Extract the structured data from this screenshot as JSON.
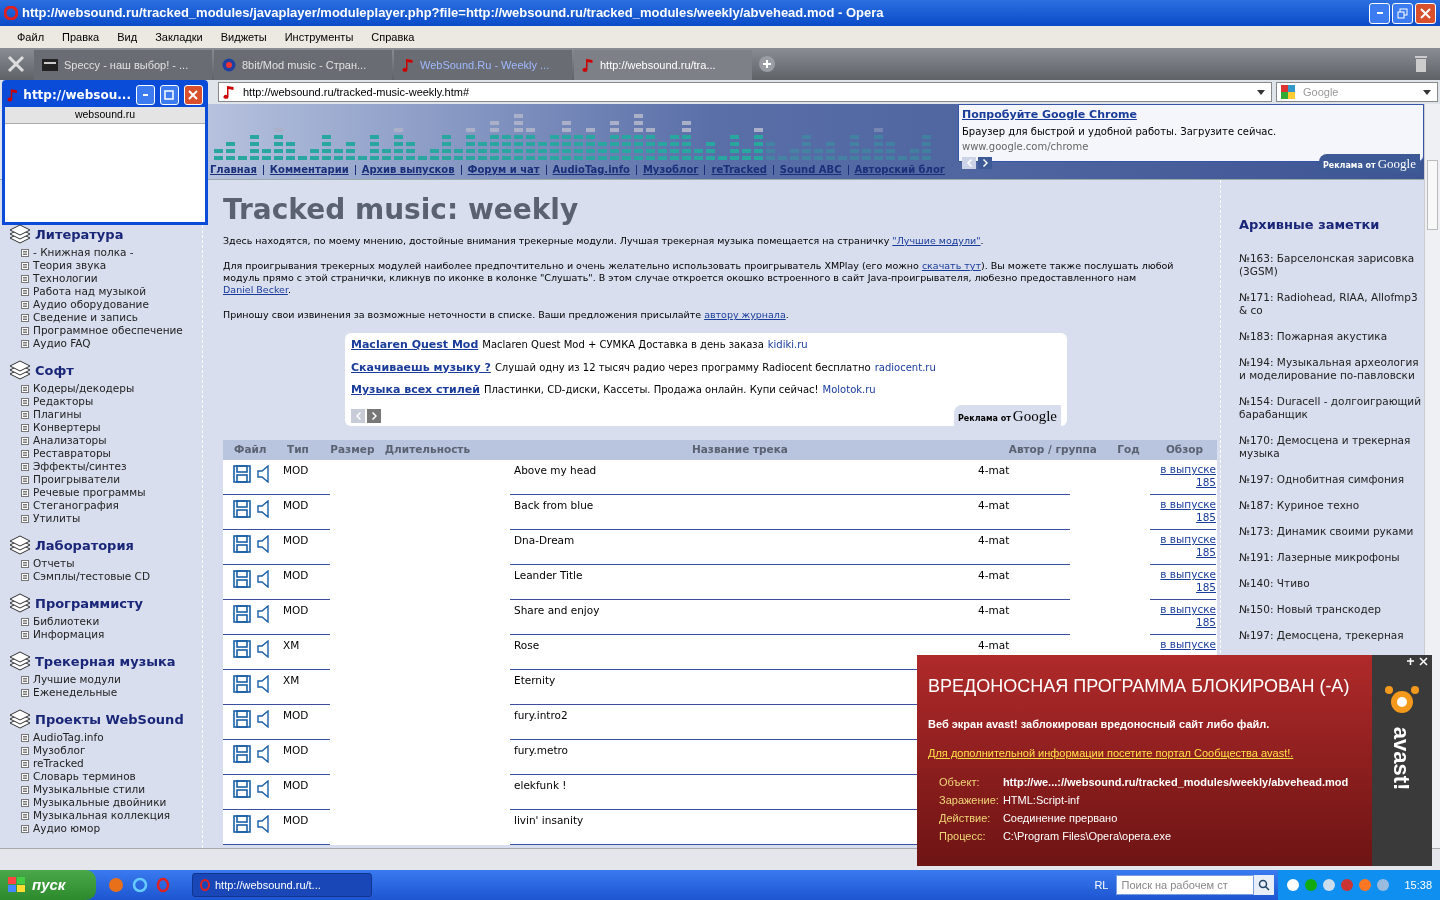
{
  "window": {
    "title": "http://websound.ru/tracked_modules/javaplayer/moduleplayer.php?file=http://websound.ru/tracked_modules/weekly/abvehead.mod - Opera"
  },
  "menu": [
    "Файл",
    "Правка",
    "Вид",
    "Закладки",
    "Виджеты",
    "Инструменты",
    "Справка"
  ],
  "tabs": [
    {
      "label": "Speccy - наш выбор! - ...",
      "selected": false
    },
    {
      "label": "8bit/Mod music - Стран...",
      "selected": false
    },
    {
      "label": "WebSound.Ru - Weekly ...",
      "selected": false
    },
    {
      "label": "http://websound.ru/tra...",
      "selected": true
    }
  ],
  "address": {
    "value": "http://websound.ru/tracked-music-weekly.htm#"
  },
  "search": {
    "placeholder": "Google"
  },
  "mini_window": {
    "title": "http://websou...",
    "header": "websound.ru"
  },
  "top_ad": {
    "title": "Попробуйте Google Chrome",
    "text": "Браузер для быстрой и удобной работы. Загрузите сейчас.",
    "url": "www.google.com/chrome",
    "by": "Реклама от",
    "brand": "Google"
  },
  "nav": [
    "Главная",
    "Комментарии",
    "Архив выпусков",
    "Форум и чат",
    "AudioTag.info",
    "Музоблог",
    "reTracked",
    "Sound ABC",
    "Авторский блог"
  ],
  "sidebar": [
    {
      "title": "Литература",
      "items": [
        "- Книжная полка -",
        "Теория звука",
        "Технологии",
        "Работа над музыкой",
        "Аудио оборудование",
        "Сведение и запись",
        "Программное обеспечение",
        "Аудио FAQ"
      ]
    },
    {
      "title": "Софт",
      "items": [
        "Кодеры/декодеры",
        "Редакторы",
        "Плагины",
        "Конвертеры",
        "Анализаторы",
        "Реставраторы",
        "Эффекты/синтез",
        "Проигрыватели",
        "Речевые программы",
        "Стеганография",
        "Утилиты"
      ]
    },
    {
      "title": "Лаборатория",
      "items": [
        "Отчеты",
        "Сэмплы/тестовые CD"
      ]
    },
    {
      "title": "Программисту",
      "items": [
        "Библиотеки",
        "Информация"
      ]
    },
    {
      "title": "Трекерная музыка",
      "items": [
        "Лучшие модули",
        "Еженедельные"
      ]
    },
    {
      "title": "Проекты WebSound",
      "items": [
        "AudioTag.info",
        "Музоблог",
        "reTracked",
        "Словарь терминов",
        "Музыкальные стили",
        "Музыкальные двойники",
        "Музыкальная коллекция",
        "Аудио юмор"
      ]
    }
  ],
  "heading": "Tracked music: weekly",
  "paragraphs": [
    {
      "text": "Здесь находятся, по моему мнению, достойные внимания трекерные модули. Лучшая трекерная музыка помещается на страничку ",
      "link": "\"Лучшие модули\"",
      "after": "."
    },
    {
      "text": "Для проигрывания трекерных модулей наиболее предпочтительно и очень желательно использовать проигрыватель XMPlay (его можно ",
      "link": "скачать тут",
      "after": "). Вы можете также послушать любой модуль прямо с этой странички, кликнув по иконке в колонке \"Слушать\". В этом случае откроется окошко встроенного в сайт Java-проигрывателя, любезно предоставленного нам ",
      "link2": "Daniel Becker",
      "after2": "."
    },
    {
      "text": "Приношу свои извинения за возможные неточности в списке. Ваши предложения присылайте ",
      "link": "автору журнала",
      "after": "."
    }
  ],
  "ads": [
    {
      "title": "Maclaren Quest Mod",
      "text": "Maclaren Quest Mod + СУМКА Доставка в день заказа",
      "site": "kidiki.ru"
    },
    {
      "title": "Скачиваешь музыку ?",
      "text": "Слушай одну из 12 тысяч радио через программу Radiocent бесплатно",
      "site": "radiocent.ru"
    },
    {
      "title": "Музыка всех стилей",
      "text": "Пластинки, CD-диски, Кассеты. Продажа онлайн. Купи сейчас!",
      "site": "Molotok.ru"
    }
  ],
  "ads_by": "Реклама от",
  "ads_brand": "Google",
  "table": {
    "columns": [
      "Файл",
      "Тип",
      "Размер",
      "Длительность",
      "Название трека",
      "Автор / группа",
      "Год",
      "Обзор"
    ],
    "rows": [
      {
        "type": "MOD",
        "title": "Above my head",
        "author": "4-mat",
        "review": "в выпуске",
        "issue": "185"
      },
      {
        "type": "MOD",
        "title": "Back from blue",
        "author": "4-mat",
        "review": "в выпуске",
        "issue": "185"
      },
      {
        "type": "MOD",
        "title": "Dna-Dream",
        "author": "4-mat",
        "review": "в выпуске",
        "issue": "185"
      },
      {
        "type": "MOD",
        "title": "Leander Title",
        "author": "4-mat",
        "review": "в выпуске",
        "issue": "185"
      },
      {
        "type": "MOD",
        "title": "Share and enjoy",
        "author": "4-mat",
        "review": "в выпуске",
        "issue": "185"
      },
      {
        "type": "XM",
        "title": "Rose",
        "author": "4-mat",
        "review": "в выпуске"
      },
      {
        "type": "XM",
        "title": "Eternity"
      },
      {
        "type": "MOD",
        "title": "fury.intro2"
      },
      {
        "type": "MOD",
        "title": "fury.metro"
      },
      {
        "type": "MOD",
        "title": "elekfunk !"
      },
      {
        "type": "MOD",
        "title": "livin' insanity"
      }
    ]
  },
  "archive": {
    "title": "Архивные заметки",
    "items": [
      "№163: Барселонская зарисовка (3GSM)",
      "№171: Radiohead, RIAA, Allofmp3 & co",
      "№183: Пожарная акустика",
      "№194: Музыкальная археология и моделирование по-павловски",
      "№154: Duracell - долгоиграющий барабанщик",
      "№170: Демосцена и трекерная музыка",
      "№197: Однобитная симфония",
      "№187: Куриное техно",
      "№173: Динамик своими руками",
      "№191: Лазерные микрофоны",
      "№140: Чтиво",
      "№150: Новый транскодер",
      "№197: Демосцена, трекерная"
    ]
  },
  "avast": {
    "title": "ВРЕДОНОСНАЯ ПРОГРАММА БЛОКИРОВАН (-А)",
    "message": "Веб экран avast! заблокирован вредоносный сайт либо файл.",
    "link": "Для дополнительной информации посетите портал Сообщества avast!.",
    "details": [
      {
        "label": "Объект:",
        "value": "http://we...://websound.ru/tracked_modules/weekly/abvehead.mod"
      },
      {
        "label": "Заражение:",
        "value": "HTML:Script-inf"
      },
      {
        "label": "Действие:",
        "value": "Соединение прервано"
      },
      {
        "label": "Процесс:",
        "value": "C:\\Program Files\\Opera\\opera.exe"
      }
    ],
    "brand": "avast!"
  },
  "taskbar": {
    "start": "пуск",
    "task": "http://websound.ru/t...",
    "lang": "RL",
    "search_placeholder": "Поиск на рабочем ст",
    "time": "15:38"
  }
}
